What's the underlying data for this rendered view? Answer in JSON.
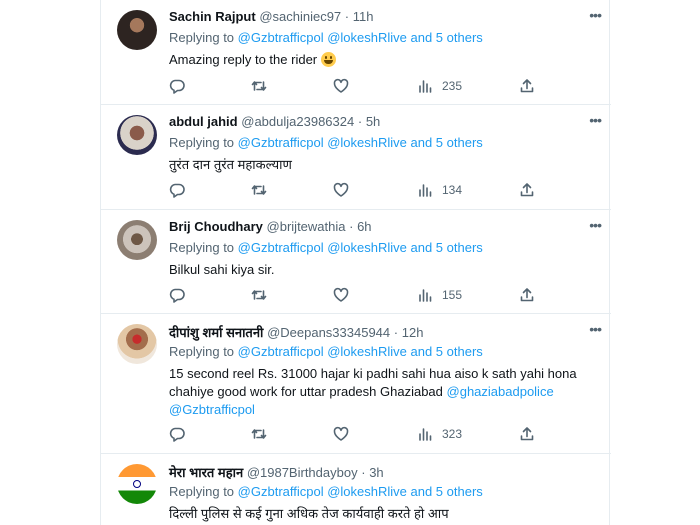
{
  "tweets": [
    {
      "name": "Sachin Rajput",
      "handle": "@sachiniec97",
      "time": "11h",
      "replying_label": "Replying to",
      "replying_to": "@Gzbtrafficpol @lokeshRlive and 5 others",
      "text": "Amazing reply to the rider",
      "emoji": "grinning-face-emoji",
      "views": "235"
    },
    {
      "name": "abdul jahid",
      "handle": "@abdulja23986324",
      "time": "5h",
      "replying_label": "Replying to",
      "replying_to": "@Gzbtrafficpol @lokeshRlive and 5 others",
      "text": "तुरंत दान तुरंत महाकल्याण",
      "views": "134"
    },
    {
      "name": "Brij Choudhary",
      "handle": "@brijtewathia",
      "time": "6h",
      "replying_label": "Replying to",
      "replying_to": "@Gzbtrafficpol @lokeshRlive and 5 others",
      "text": "Bilkul sahi kiya sir.",
      "views": "155"
    },
    {
      "name": "दीपांशु शर्मा सनातनी",
      "handle": "@Deepans33345944",
      "time": "12h",
      "replying_label": "Replying to",
      "replying_to": "@Gzbtrafficpol @lokeshRlive and 5 others",
      "text": "15 second reel Rs. 31000 hajar ki padhi sahi hua aiso k sath yahi hona chahiye good work for uttar pradesh Ghaziabad",
      "text_mention_1": "@ghaziabadpolice",
      "text_mention_2": "@Gzbtrafficpol",
      "views": "323"
    },
    {
      "name": "मेरा भारत महान",
      "handle": "@1987Birthdayboy",
      "time": "3h",
      "replying_label": "Replying to",
      "replying_to": "@Gzbtrafficpol @lokeshRlive and 5 others",
      "text": "दिल्ली पुलिस से कई गुना अधिक तेज कार्यवाही करते हो आप"
    }
  ],
  "separator": "·",
  "colors": {
    "link": "#1d9bf0",
    "secondary_text": "#536471",
    "primary_text": "#0f1419",
    "divider": "#e6ecf0"
  },
  "icons": {
    "more": "more-icon",
    "reply": "reply-icon",
    "retweet": "retweet-icon",
    "like": "like-icon",
    "views": "views-icon",
    "share": "share-icon"
  }
}
